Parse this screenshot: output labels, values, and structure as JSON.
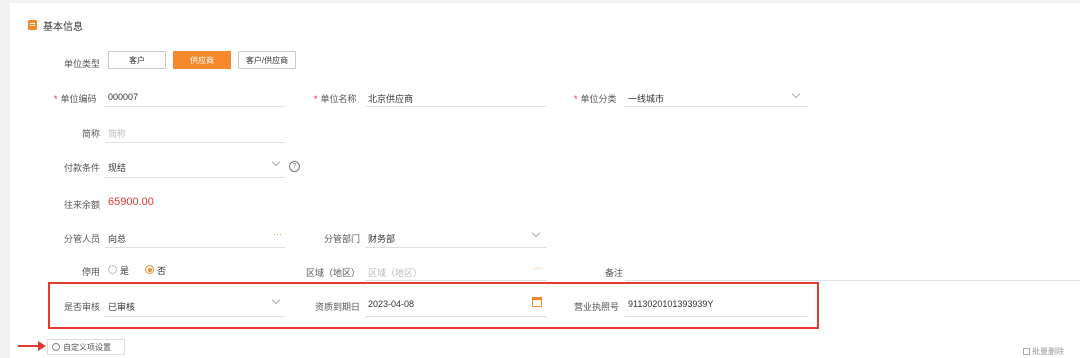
{
  "section": {
    "title": "基本信息",
    "icon": "document-icon"
  },
  "unit_type": {
    "label": "单位类型",
    "options": [
      "客户",
      "供应商",
      "客户/供应商"
    ],
    "selected": "供应商"
  },
  "unit_code": {
    "label": "单位编码",
    "value": "000007"
  },
  "unit_name": {
    "label": "单位名称",
    "value": "北京供应商"
  },
  "unit_category": {
    "label": "单位分类",
    "value": "一线城市"
  },
  "short_name": {
    "label": "简称",
    "placeholder": "简称"
  },
  "payment_terms": {
    "label": "付款条件",
    "value": "现结",
    "help": "?"
  },
  "balance": {
    "label": "往来余额",
    "value": "65900.00",
    "color": "#e53935"
  },
  "manager": {
    "label": "分管人员",
    "value": "向总"
  },
  "department": {
    "label": "分管部门",
    "value": "财务部"
  },
  "disabled": {
    "label": "停用",
    "yes": "是",
    "no": "否",
    "selected": "否"
  },
  "region": {
    "label": "区域（地区）",
    "placeholder": "区域（地区）"
  },
  "remark": {
    "label": "备注"
  },
  "audited": {
    "label": "是否审核",
    "value": "已审核"
  },
  "qualification_expiry": {
    "label": "资质到期日",
    "value": "2023-04-08"
  },
  "license_no": {
    "label": "营业执照号",
    "value": "9113020101393939Y"
  },
  "custom_fields_button": {
    "label": "自定义项设置"
  },
  "bulk_delete": {
    "label": "批量删除"
  },
  "accent_color": "#f5892c"
}
